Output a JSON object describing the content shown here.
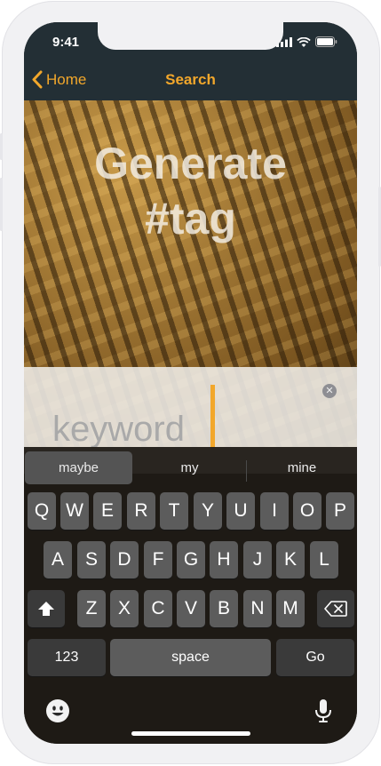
{
  "status": {
    "time": "9:41"
  },
  "nav": {
    "back_label": "Home",
    "title": "Search"
  },
  "hero": {
    "title_line1": "Generate",
    "title_line2": "#tag"
  },
  "search": {
    "placeholder": "keyword",
    "value": ""
  },
  "suggestions": [
    "maybe",
    "my",
    "mine"
  ],
  "keyboard": {
    "row1": [
      "Q",
      "W",
      "E",
      "R",
      "T",
      "Y",
      "U",
      "I",
      "O",
      "P"
    ],
    "row2": [
      "A",
      "S",
      "D",
      "F",
      "G",
      "H",
      "J",
      "K",
      "L"
    ],
    "row3": [
      "Z",
      "X",
      "C",
      "V",
      "B",
      "N",
      "M"
    ],
    "numbers_label": "123",
    "space_label": "space",
    "go_label": "Go"
  },
  "colors": {
    "accent": "#f2a72b",
    "bar_bg": "#232f35"
  },
  "icons": [
    "chevron-left-icon",
    "signal-icon",
    "wifi-icon",
    "battery-icon",
    "clear-icon",
    "shift-icon",
    "backspace-icon",
    "emoji-icon",
    "microphone-icon"
  ]
}
